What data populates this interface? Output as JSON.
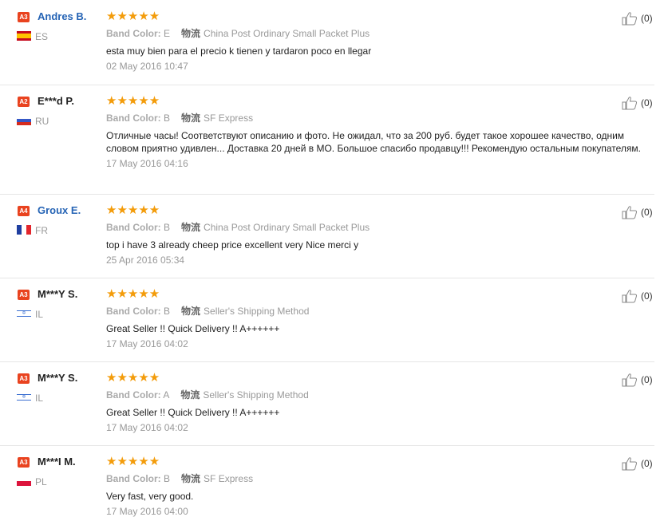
{
  "reviews": [
    {
      "level": "A3",
      "name": "Andres B.",
      "name_is_link": true,
      "country": "ES",
      "stars": "★★★★★",
      "color_label": "Band Color:",
      "color_value": "E",
      "shipping_label": "物流",
      "shipping": "China Post Ordinary Small Packet Plus",
      "text": "esta muy bien para el precio k tienen y tardaron poco en llegar",
      "date": "02 May 2016 10:47",
      "helpful": "(0)"
    },
    {
      "level": "A2",
      "name": "E***d P.",
      "name_is_link": false,
      "country": "RU",
      "stars": "★★★★★",
      "color_label": "Band Color:",
      "color_value": "B",
      "shipping_label": "物流",
      "shipping": "SF Express",
      "text": "Отличные часы! Соответствуют описанию и фото. Не ожидал, что за 200 руб. будет такое хорошее качество, одним словом приятно удивлен... Доставка 20 дней в МО. Большое спасибо продавцу!!! Рекомендую остальным покупателям.",
      "date": "17 May 2016 04:16",
      "helpful": "(0)"
    },
    {
      "level": "A4",
      "name": "Groux E.",
      "name_is_link": true,
      "country": "FR",
      "stars": "★★★★★",
      "color_label": "Band Color:",
      "color_value": "B",
      "shipping_label": "物流",
      "shipping": "China Post Ordinary Small Packet Plus",
      "text": "top i have 3 already cheep price excellent very Nice merci y",
      "date": "25 Apr 2016 05:34",
      "helpful": "(0)"
    },
    {
      "level": "A3",
      "name": "M***Y S.",
      "name_is_link": false,
      "country": "IL",
      "stars": "★★★★★",
      "color_label": "Band Color:",
      "color_value": "B",
      "shipping_label": "物流",
      "shipping": "Seller's Shipping Method",
      "text": "Great Seller !! Quick Delivery !! A++++++",
      "date": "17 May 2016 04:02",
      "helpful": "(0)"
    },
    {
      "level": "A3",
      "name": "M***Y S.",
      "name_is_link": false,
      "country": "IL",
      "stars": "★★★★★",
      "color_label": "Band Color:",
      "color_value": "A",
      "shipping_label": "物流",
      "shipping": "Seller's Shipping Method",
      "text": "Great Seller !! Quick Delivery !! A++++++",
      "date": "17 May 2016 04:02",
      "helpful": "(0)"
    },
    {
      "level": "A3",
      "name": "M***I M.",
      "name_is_link": false,
      "country": "PL",
      "stars": "★★★★★",
      "color_label": "Band Color:",
      "color_value": "B",
      "shipping_label": "物流",
      "shipping": "SF Express",
      "text": "Very fast, very good.",
      "date": "17 May 2016 04:00",
      "helpful": "(0)"
    }
  ],
  "theme": {
    "badge_color": "#e9431f",
    "star_color": "#f39c0b",
    "link_color": "#2664b5"
  },
  "icons": {
    "flag": "country-flag-icon",
    "helpful": "thumbs-up-icon"
  }
}
